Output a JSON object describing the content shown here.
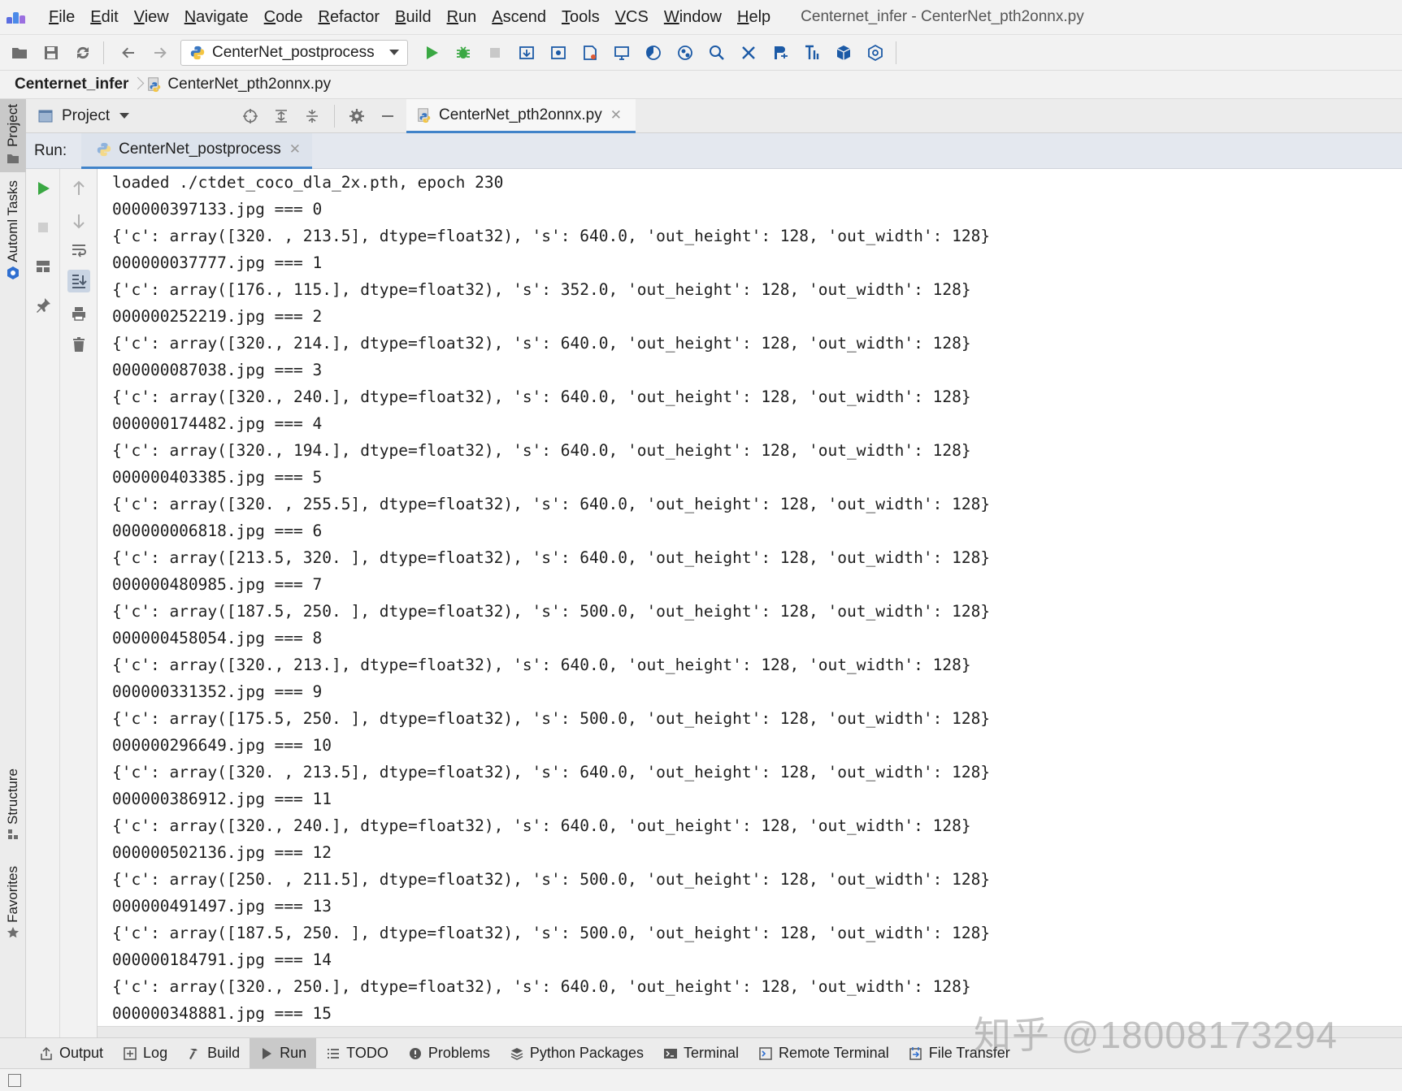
{
  "menubar": {
    "items": [
      "File",
      "Edit",
      "View",
      "Navigate",
      "Code",
      "Refactor",
      "Build",
      "Run",
      "Ascend",
      "Tools",
      "VCS",
      "Window",
      "Help"
    ],
    "window_title": "Centernet_infer - CenterNet_pth2onnx.py"
  },
  "toolbar": {
    "run_config": "CenterNet_postprocess"
  },
  "breadcrumb": {
    "project": "Centernet_infer",
    "file": "CenterNet_pth2onnx.py"
  },
  "left_strip": {
    "project": "Project",
    "automl": "Automl Tasks",
    "structure": "Structure",
    "favorites": "Favorites"
  },
  "project_panel": {
    "title": "Project"
  },
  "editor": {
    "tab": "CenterNet_pth2onnx.py"
  },
  "run_panel": {
    "label": "Run:",
    "tab": "CenterNet_postprocess"
  },
  "console": {
    "lines": [
      "loaded ./ctdet_coco_dla_2x.pth, epoch 230",
      "000000397133.jpg === 0",
      "{'c': array([320. , 213.5], dtype=float32), 's': 640.0, 'out_height': 128, 'out_width': 128}",
      "000000037777.jpg === 1",
      "{'c': array([176., 115.], dtype=float32), 's': 352.0, 'out_height': 128, 'out_width': 128}",
      "000000252219.jpg === 2",
      "{'c': array([320., 214.], dtype=float32), 's': 640.0, 'out_height': 128, 'out_width': 128}",
      "000000087038.jpg === 3",
      "{'c': array([320., 240.], dtype=float32), 's': 640.0, 'out_height': 128, 'out_width': 128}",
      "000000174482.jpg === 4",
      "{'c': array([320., 194.], dtype=float32), 's': 640.0, 'out_height': 128, 'out_width': 128}",
      "000000403385.jpg === 5",
      "{'c': array([320. , 255.5], dtype=float32), 's': 640.0, 'out_height': 128, 'out_width': 128}",
      "000000006818.jpg === 6",
      "{'c': array([213.5, 320. ], dtype=float32), 's': 640.0, 'out_height': 128, 'out_width': 128}",
      "000000480985.jpg === 7",
      "{'c': array([187.5, 250. ], dtype=float32), 's': 500.0, 'out_height': 128, 'out_width': 128}",
      "000000458054.jpg === 8",
      "{'c': array([320., 213.], dtype=float32), 's': 640.0, 'out_height': 128, 'out_width': 128}",
      "000000331352.jpg === 9",
      "{'c': array([175.5, 250. ], dtype=float32), 's': 500.0, 'out_height': 128, 'out_width': 128}",
      "000000296649.jpg === 10",
      "{'c': array([320. , 213.5], dtype=float32), 's': 640.0, 'out_height': 128, 'out_width': 128}",
      "000000386912.jpg === 11",
      "{'c': array([320., 240.], dtype=float32), 's': 640.0, 'out_height': 128, 'out_width': 128}",
      "000000502136.jpg === 12",
      "{'c': array([250. , 211.5], dtype=float32), 's': 500.0, 'out_height': 128, 'out_width': 128}",
      "000000491497.jpg === 13",
      "{'c': array([187.5, 250. ], dtype=float32), 's': 500.0, 'out_height': 128, 'out_width': 128}",
      "000000184791.jpg === 14",
      "{'c': array([320., 250.], dtype=float32), 's': 640.0, 'out_height': 128, 'out_width': 128}",
      "000000348881.jpg === 15"
    ]
  },
  "bottom_bar": {
    "tabs": [
      "Output",
      "Log",
      "Build",
      "Run",
      "TODO",
      "Problems",
      "Python Packages",
      "Terminal",
      "Remote Terminal",
      "File Transfer"
    ],
    "active": "Run"
  },
  "watermark": "知乎 @18008173294",
  "colors": {
    "accent": "#4083c9",
    "run_green": "#3aa843",
    "console_bg": "#ffffff"
  }
}
